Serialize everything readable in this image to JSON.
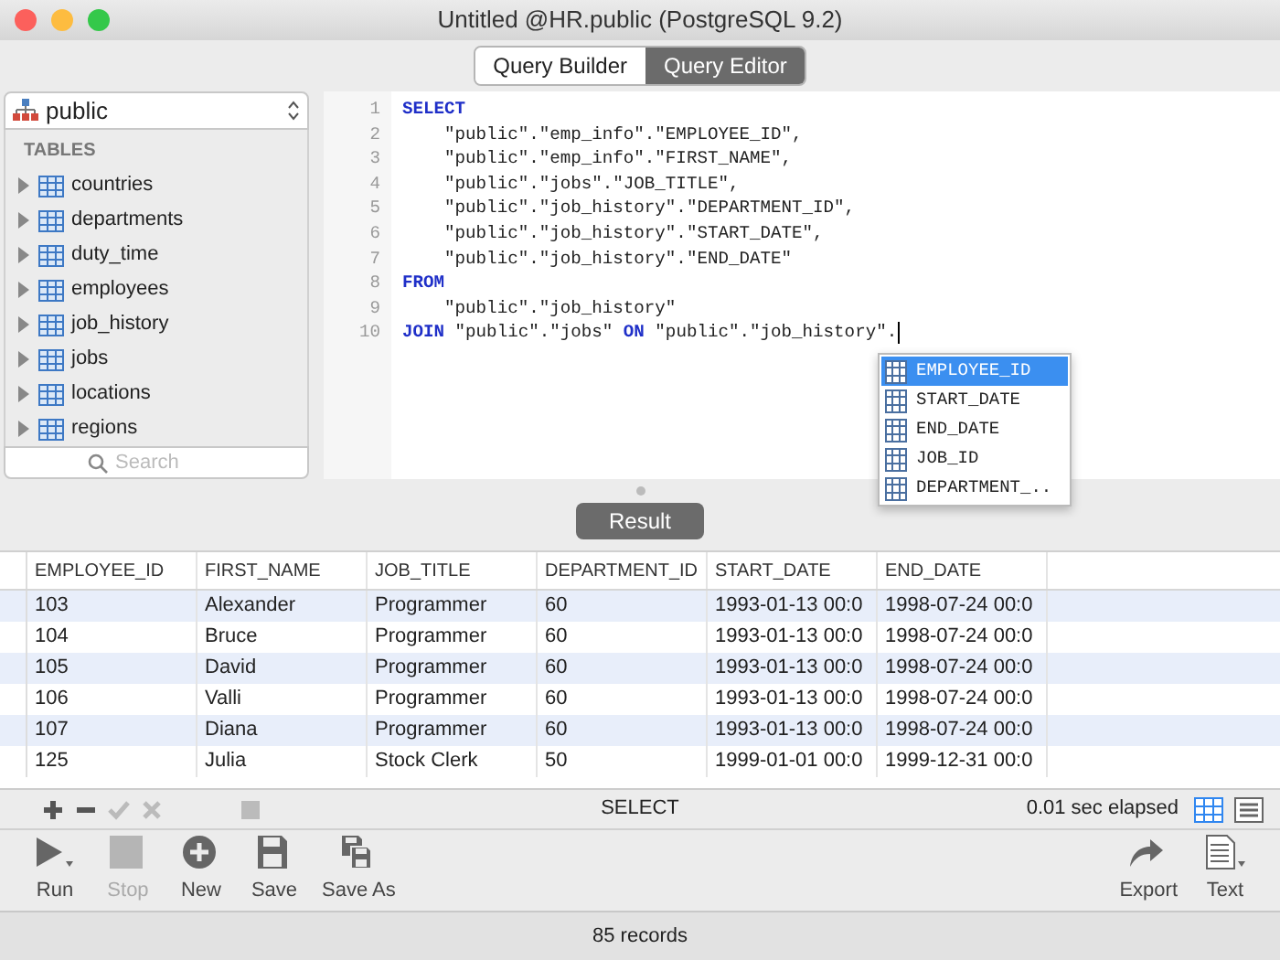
{
  "window": {
    "title": "Untitled @HR.public (PostgreSQL 9.2)"
  },
  "tabs": [
    {
      "label": "Query Builder",
      "selected": false
    },
    {
      "label": "Query Editor",
      "selected": true
    }
  ],
  "sidebar": {
    "schema": "public",
    "section": "TABLES",
    "search": {
      "placeholder": "Search"
    },
    "items": [
      {
        "label": "countries",
        "expanded": false
      },
      {
        "label": "departments",
        "expanded": false
      },
      {
        "label": "duty_time",
        "expanded": false
      },
      {
        "label": "employees",
        "expanded": false
      },
      {
        "label": "job_history",
        "expanded": false
      },
      {
        "label": "jobs",
        "expanded": false
      },
      {
        "label": "locations",
        "expanded": false
      },
      {
        "label": "regions",
        "expanded": false
      }
    ]
  },
  "editor": {
    "lines": [
      {
        "number": "1",
        "tokens": [
          {
            "kind": "keyword",
            "text": "SELECT"
          }
        ]
      },
      {
        "number": "2",
        "tokens": [
          {
            "kind": "plain",
            "text": "    \"public\".\"emp_info\".\"EMPLOYEE_ID\","
          }
        ]
      },
      {
        "number": "3",
        "tokens": [
          {
            "kind": "plain",
            "text": "    \"public\".\"emp_info\".\"FIRST_NAME\","
          }
        ]
      },
      {
        "number": "4",
        "tokens": [
          {
            "kind": "plain",
            "text": "    \"public\".\"jobs\".\"JOB_TITLE\","
          }
        ]
      },
      {
        "number": "5",
        "tokens": [
          {
            "kind": "plain",
            "text": "    \"public\".\"job_history\".\"DEPARTMENT_ID\","
          }
        ]
      },
      {
        "number": "6",
        "tokens": [
          {
            "kind": "plain",
            "text": "    \"public\".\"job_history\".\"START_DATE\","
          }
        ]
      },
      {
        "number": "7",
        "tokens": [
          {
            "kind": "plain",
            "text": "    \"public\".\"job_history\".\"END_DATE\""
          }
        ]
      },
      {
        "number": "8",
        "tokens": [
          {
            "kind": "keyword",
            "text": "FROM"
          }
        ]
      },
      {
        "number": "9",
        "tokens": [
          {
            "kind": "plain",
            "text": "    \"public\".\"job_history\""
          }
        ]
      },
      {
        "number": "10",
        "tokens": [
          {
            "kind": "keyword",
            "text": "JOIN"
          },
          {
            "kind": "plain",
            "text": " \"public\".\"jobs\" "
          },
          {
            "kind": "keyword",
            "text": "ON"
          },
          {
            "kind": "plain",
            "text": " \"public\".\"job_history\"."
          }
        ],
        "caret": true
      }
    ],
    "suggestions": [
      {
        "label": "EMPLOYEE_ID",
        "selected": true
      },
      {
        "label": "START_DATE",
        "selected": false
      },
      {
        "label": "END_DATE",
        "selected": false
      },
      {
        "label": "JOB_ID",
        "selected": false
      },
      {
        "label": "DEPARTMENT_..",
        "selected": false
      }
    ]
  },
  "result_button": "Result",
  "table": {
    "columns": [
      "EMPLOYEE_ID",
      "FIRST_NAME",
      "JOB_TITLE",
      "DEPARTMENT_ID",
      "START_DATE",
      "END_DATE"
    ],
    "rows": [
      [
        "103",
        "Alexander",
        "Programmer",
        "60",
        "1993-01-13 00:0",
        "1998-07-24 00:0"
      ],
      [
        "104",
        "Bruce",
        "Programmer",
        "60",
        "1993-01-13 00:0",
        "1998-07-24 00:0"
      ],
      [
        "105",
        "David",
        "Programmer",
        "60",
        "1993-01-13 00:0",
        "1998-07-24 00:0"
      ],
      [
        "106",
        "Valli",
        "Programmer",
        "60",
        "1993-01-13 00:0",
        "1998-07-24 00:0"
      ],
      [
        "107",
        "Diana",
        "Programmer",
        "60",
        "1993-01-13 00:0",
        "1998-07-24 00:0"
      ],
      [
        "125",
        "Julia",
        "Stock Clerk",
        "50",
        "1999-01-01 00:0",
        "1999-12-31 00:0"
      ]
    ]
  },
  "edit_bar": {
    "tools": [
      {
        "kind": "plus",
        "disabled": false
      },
      {
        "kind": "minus",
        "disabled": false
      },
      {
        "kind": "check",
        "disabled": true
      },
      {
        "kind": "cross",
        "disabled": true
      },
      {
        "kind": "stop",
        "disabled": true
      }
    ],
    "statement": "SELECT",
    "elapsed": "0.01 sec elapsed",
    "views": [
      {
        "kind": "grid",
        "selected": true
      },
      {
        "kind": "form",
        "selected": false
      }
    ]
  },
  "toolbar": {
    "left": [
      {
        "kind": "run",
        "label": "Run",
        "disabled": false
      },
      {
        "kind": "stop",
        "label": "Stop",
        "disabled": true
      },
      {
        "kind": "new",
        "label": "New",
        "disabled": false
      },
      {
        "kind": "save",
        "label": "Save",
        "disabled": false
      },
      {
        "kind": "saveas",
        "label": "Save As",
        "disabled": false
      }
    ],
    "right": [
      {
        "kind": "export",
        "label": "Export",
        "disabled": false
      },
      {
        "kind": "text",
        "label": "Text",
        "disabled": false
      }
    ]
  },
  "status_bar": "85 records"
}
